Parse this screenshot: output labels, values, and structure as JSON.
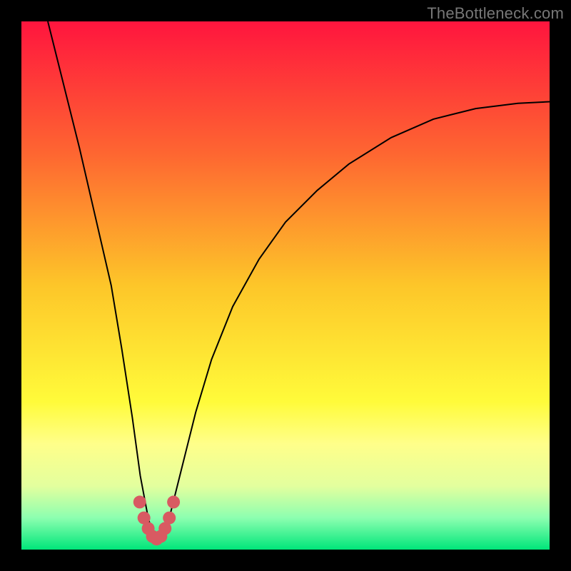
{
  "watermark": "TheBottleneck.com",
  "chart_data": {
    "type": "line",
    "title": "",
    "xlabel": "",
    "ylabel": "",
    "xlim": [
      0,
      100
    ],
    "ylim": [
      0,
      100
    ],
    "grid": false,
    "legend": false,
    "background_gradient": {
      "stops": [
        {
          "pos": 0.0,
          "color": "#ff153e"
        },
        {
          "pos": 0.25,
          "color": "#fe6631"
        },
        {
          "pos": 0.5,
          "color": "#fdc629"
        },
        {
          "pos": 0.72,
          "color": "#fffb3a"
        },
        {
          "pos": 0.8,
          "color": "#ffff8a"
        },
        {
          "pos": 0.88,
          "color": "#e3ff9e"
        },
        {
          "pos": 0.94,
          "color": "#8cffb0"
        },
        {
          "pos": 1.0,
          "color": "#00e67a"
        }
      ]
    },
    "series": [
      {
        "name": "bottleneck-curve",
        "color": "#000000",
        "stroke_width": 2,
        "x": [
          5,
          8,
          11,
          14,
          17,
          19,
          21,
          22.5,
          24,
          25,
          26,
          27,
          28,
          30,
          33,
          36,
          40,
          45,
          50,
          56,
          62,
          70,
          78,
          86,
          94,
          100
        ],
        "values": [
          100,
          88,
          76,
          63,
          50,
          38,
          25,
          14,
          6,
          2.5,
          2,
          2.5,
          6,
          14,
          26,
          36,
          46,
          55,
          62,
          68,
          73,
          78,
          81.5,
          83.5,
          84.5,
          84.8
        ]
      }
    ],
    "valley_marker": {
      "color": "#d85a62",
      "radius": 9,
      "points_x": [
        22.4,
        23.2,
        24.0,
        24.8,
        25.6,
        26.4,
        27.2,
        28.0,
        28.8
      ],
      "points_y": [
        9,
        6,
        4,
        2.5,
        2,
        2.5,
        4,
        6,
        9
      ]
    }
  }
}
